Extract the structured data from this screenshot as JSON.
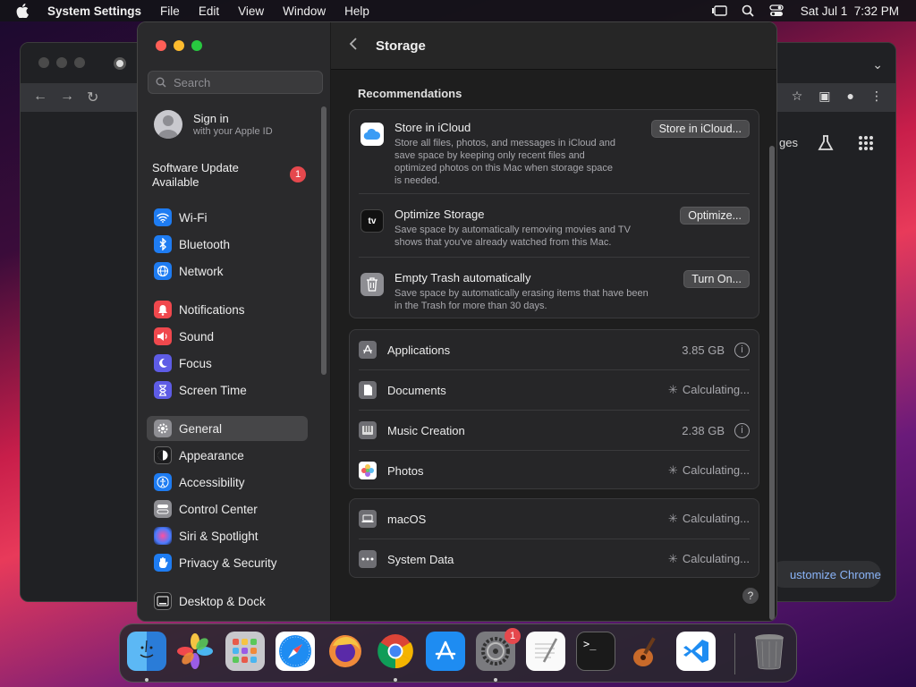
{
  "menubar": {
    "app_name": "System Settings",
    "menus": [
      "File",
      "Edit",
      "View",
      "Window",
      "Help"
    ],
    "datetime": "Sat Jul 1  7:32 PM"
  },
  "chrome": {
    "partial_text": "ges",
    "customize_label": "ustomize Chrome"
  },
  "sidebar": {
    "search_placeholder": "Search",
    "apple_id": {
      "title": "Sign in",
      "subtitle": "with your Apple ID"
    },
    "software_update": {
      "label": "Software Update Available",
      "badge": "1"
    },
    "items": [
      {
        "label": "Wi-Fi",
        "icon": "wifi-icon",
        "color": "#1e7cf2"
      },
      {
        "label": "Bluetooth",
        "icon": "bluetooth-icon",
        "color": "#1e7cf2"
      },
      {
        "label": "Network",
        "icon": "globe-icon",
        "color": "#1e7cf2"
      },
      {
        "label": "Notifications",
        "icon": "bell-icon",
        "color": "#f0484d"
      },
      {
        "label": "Sound",
        "icon": "speaker-icon",
        "color": "#f0484d"
      },
      {
        "label": "Focus",
        "icon": "moon-icon",
        "color": "#5e5ce6"
      },
      {
        "label": "Screen Time",
        "icon": "hourglass-icon",
        "color": "#5e5ce6"
      },
      {
        "label": "General",
        "icon": "gear-icon",
        "color": "#8e8e93"
      },
      {
        "label": "Appearance",
        "icon": "appearance-icon",
        "color": "#1c1c1e"
      },
      {
        "label": "Accessibility",
        "icon": "accessibility-icon",
        "color": "#1e7cf2"
      },
      {
        "label": "Control Center",
        "icon": "control-center-icon",
        "color": "#8e8e93"
      },
      {
        "label": "Siri & Spotlight",
        "icon": "siri-icon",
        "color": "#3a3a8c"
      },
      {
        "label": "Privacy & Security",
        "icon": "hand-icon",
        "color": "#1e7cf2"
      },
      {
        "label": "Desktop & Dock",
        "icon": "dock-icon",
        "color": "#1c1c1e"
      }
    ]
  },
  "main": {
    "title": "Storage",
    "recommendations_heading": "Recommendations",
    "recommendations": [
      {
        "title": "Store in iCloud",
        "desc_lines": [
          "Store all files, photos, and messages in iCloud and",
          "save space by keeping only recent files and",
          "optimized photos on this Mac when storage space",
          "is needed."
        ],
        "button": "Store in iCloud..."
      },
      {
        "title": "Optimize Storage",
        "desc_lines": [
          "Save space by automatically removing movies and TV",
          "shows that you've already watched from this Mac."
        ],
        "button": "Optimize..."
      },
      {
        "title": "Empty Trash automatically",
        "desc_lines": [
          "Save space by automatically erasing items that have been",
          "in the Trash for more than 30 days."
        ],
        "button": "Turn On..."
      }
    ],
    "storage_items": [
      {
        "label": "Applications",
        "value": "3.85 GB",
        "info": true
      },
      {
        "label": "Documents",
        "value": "Calculating...",
        "info": false
      },
      {
        "label": "Music Creation",
        "value": "2.38 GB",
        "info": true
      },
      {
        "label": "Photos",
        "value": "Calculating...",
        "info": false
      }
    ],
    "system_items": [
      {
        "label": "macOS",
        "value": "Calculating..."
      },
      {
        "label": "System Data",
        "value": "Calculating..."
      }
    ],
    "help": "?",
    "appletv_text": "tv"
  },
  "dock": {
    "apps": [
      "finder-icon",
      "photos-icon",
      "launchpad-icon",
      "safari-icon",
      "firefox-icon",
      "chrome-icon",
      "app-store-icon",
      "system-settings-icon",
      "textedit-icon",
      "terminal-icon",
      "garageband-icon",
      "vscode-icon",
      "trash-icon"
    ],
    "settings_badge": "1",
    "terminal_prompt": ">_"
  }
}
